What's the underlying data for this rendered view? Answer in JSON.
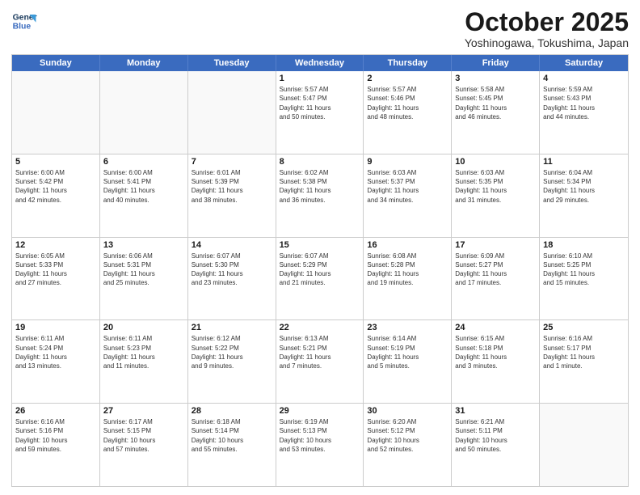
{
  "header": {
    "logo_line1": "General",
    "logo_line2": "Blue",
    "month": "October 2025",
    "location": "Yoshinogawa, Tokushima, Japan"
  },
  "day_headers": [
    "Sunday",
    "Monday",
    "Tuesday",
    "Wednesday",
    "Thursday",
    "Friday",
    "Saturday"
  ],
  "weeks": [
    [
      {
        "day": "",
        "info": ""
      },
      {
        "day": "",
        "info": ""
      },
      {
        "day": "",
        "info": ""
      },
      {
        "day": "1",
        "info": "Sunrise: 5:57 AM\nSunset: 5:47 PM\nDaylight: 11 hours\nand 50 minutes."
      },
      {
        "day": "2",
        "info": "Sunrise: 5:57 AM\nSunset: 5:46 PM\nDaylight: 11 hours\nand 48 minutes."
      },
      {
        "day": "3",
        "info": "Sunrise: 5:58 AM\nSunset: 5:45 PM\nDaylight: 11 hours\nand 46 minutes."
      },
      {
        "day": "4",
        "info": "Sunrise: 5:59 AM\nSunset: 5:43 PM\nDaylight: 11 hours\nand 44 minutes."
      }
    ],
    [
      {
        "day": "5",
        "info": "Sunrise: 6:00 AM\nSunset: 5:42 PM\nDaylight: 11 hours\nand 42 minutes."
      },
      {
        "day": "6",
        "info": "Sunrise: 6:00 AM\nSunset: 5:41 PM\nDaylight: 11 hours\nand 40 minutes."
      },
      {
        "day": "7",
        "info": "Sunrise: 6:01 AM\nSunset: 5:39 PM\nDaylight: 11 hours\nand 38 minutes."
      },
      {
        "day": "8",
        "info": "Sunrise: 6:02 AM\nSunset: 5:38 PM\nDaylight: 11 hours\nand 36 minutes."
      },
      {
        "day": "9",
        "info": "Sunrise: 6:03 AM\nSunset: 5:37 PM\nDaylight: 11 hours\nand 34 minutes."
      },
      {
        "day": "10",
        "info": "Sunrise: 6:03 AM\nSunset: 5:35 PM\nDaylight: 11 hours\nand 31 minutes."
      },
      {
        "day": "11",
        "info": "Sunrise: 6:04 AM\nSunset: 5:34 PM\nDaylight: 11 hours\nand 29 minutes."
      }
    ],
    [
      {
        "day": "12",
        "info": "Sunrise: 6:05 AM\nSunset: 5:33 PM\nDaylight: 11 hours\nand 27 minutes."
      },
      {
        "day": "13",
        "info": "Sunrise: 6:06 AM\nSunset: 5:31 PM\nDaylight: 11 hours\nand 25 minutes."
      },
      {
        "day": "14",
        "info": "Sunrise: 6:07 AM\nSunset: 5:30 PM\nDaylight: 11 hours\nand 23 minutes."
      },
      {
        "day": "15",
        "info": "Sunrise: 6:07 AM\nSunset: 5:29 PM\nDaylight: 11 hours\nand 21 minutes."
      },
      {
        "day": "16",
        "info": "Sunrise: 6:08 AM\nSunset: 5:28 PM\nDaylight: 11 hours\nand 19 minutes."
      },
      {
        "day": "17",
        "info": "Sunrise: 6:09 AM\nSunset: 5:27 PM\nDaylight: 11 hours\nand 17 minutes."
      },
      {
        "day": "18",
        "info": "Sunrise: 6:10 AM\nSunset: 5:25 PM\nDaylight: 11 hours\nand 15 minutes."
      }
    ],
    [
      {
        "day": "19",
        "info": "Sunrise: 6:11 AM\nSunset: 5:24 PM\nDaylight: 11 hours\nand 13 minutes."
      },
      {
        "day": "20",
        "info": "Sunrise: 6:11 AM\nSunset: 5:23 PM\nDaylight: 11 hours\nand 11 minutes."
      },
      {
        "day": "21",
        "info": "Sunrise: 6:12 AM\nSunset: 5:22 PM\nDaylight: 11 hours\nand 9 minutes."
      },
      {
        "day": "22",
        "info": "Sunrise: 6:13 AM\nSunset: 5:21 PM\nDaylight: 11 hours\nand 7 minutes."
      },
      {
        "day": "23",
        "info": "Sunrise: 6:14 AM\nSunset: 5:19 PM\nDaylight: 11 hours\nand 5 minutes."
      },
      {
        "day": "24",
        "info": "Sunrise: 6:15 AM\nSunset: 5:18 PM\nDaylight: 11 hours\nand 3 minutes."
      },
      {
        "day": "25",
        "info": "Sunrise: 6:16 AM\nSunset: 5:17 PM\nDaylight: 11 hours\nand 1 minute."
      }
    ],
    [
      {
        "day": "26",
        "info": "Sunrise: 6:16 AM\nSunset: 5:16 PM\nDaylight: 10 hours\nand 59 minutes."
      },
      {
        "day": "27",
        "info": "Sunrise: 6:17 AM\nSunset: 5:15 PM\nDaylight: 10 hours\nand 57 minutes."
      },
      {
        "day": "28",
        "info": "Sunrise: 6:18 AM\nSunset: 5:14 PM\nDaylight: 10 hours\nand 55 minutes."
      },
      {
        "day": "29",
        "info": "Sunrise: 6:19 AM\nSunset: 5:13 PM\nDaylight: 10 hours\nand 53 minutes."
      },
      {
        "day": "30",
        "info": "Sunrise: 6:20 AM\nSunset: 5:12 PM\nDaylight: 10 hours\nand 52 minutes."
      },
      {
        "day": "31",
        "info": "Sunrise: 6:21 AM\nSunset: 5:11 PM\nDaylight: 10 hours\nand 50 minutes."
      },
      {
        "day": "",
        "info": ""
      }
    ]
  ]
}
